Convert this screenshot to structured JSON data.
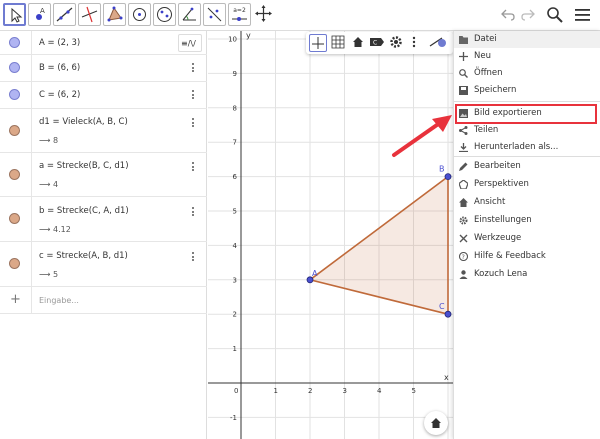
{
  "algebra": {
    "rows": [
      {
        "text": "A = (2, 3)",
        "result": ""
      },
      {
        "text": "B = (6, 6)",
        "result": ""
      },
      {
        "text": "C = (6, 2)",
        "result": ""
      },
      {
        "text": "d1 = Vieleck(A, B, C)",
        "result": "⟶ 8"
      },
      {
        "text": "a = Strecke(B, C, d1)",
        "result": "⟶ 4"
      },
      {
        "text": "b = Strecke(C, A, d1)",
        "result": "⟶ 4.12"
      },
      {
        "text": "c = Strecke(A, B, d1)",
        "result": "⟶ 5"
      }
    ],
    "input_placeholder": "Eingabe..."
  },
  "graphics": {
    "x_ticks": [
      "0",
      "1",
      "2",
      "3",
      "4",
      "5"
    ],
    "y_ticks": [
      "10",
      "9",
      "8",
      "7",
      "6",
      "5",
      "4",
      "3",
      "2",
      "1",
      "0",
      "-1"
    ],
    "x_axis_label": "x",
    "y_axis_label": "y",
    "points": [
      {
        "name": "A",
        "x": 2,
        "y": 3
      },
      {
        "name": "B",
        "x": 6,
        "y": 6
      },
      {
        "name": "C",
        "x": 6,
        "y": 2
      }
    ],
    "polygon_color": "#c06a3a",
    "point_color": "#4a4fd0"
  },
  "menu": {
    "items": [
      {
        "label": "Datei",
        "icon": "folder-icon"
      },
      {
        "label": "Neu",
        "icon": "plus-icon"
      },
      {
        "label": "Öffnen",
        "icon": "search-icon"
      },
      {
        "label": "Speichern",
        "icon": "save-icon"
      },
      {
        "label": "Bild exportieren",
        "icon": "image-icon"
      },
      {
        "label": "Teilen",
        "icon": "share-icon"
      },
      {
        "label": "Herunterladen als...",
        "icon": "download-icon"
      },
      {
        "label": "Bearbeiten",
        "icon": "pencil-icon"
      },
      {
        "label": "Perspektiven",
        "icon": "perspectives-icon"
      },
      {
        "label": "Ansicht",
        "icon": "home-icon"
      },
      {
        "label": "Einstellungen",
        "icon": "gear-icon"
      },
      {
        "label": "Werkzeuge",
        "icon": "tools-icon"
      },
      {
        "label": "Hilfe & Feedback",
        "icon": "help-icon"
      },
      {
        "label": "Kozuch Lena",
        "icon": "user-icon"
      }
    ]
  },
  "toolbar": {
    "tool_label_equals": "a=2"
  },
  "colors": {
    "highlight": "#e8323c",
    "arrow": "#e8323c",
    "accent": "#6f7bd1"
  }
}
